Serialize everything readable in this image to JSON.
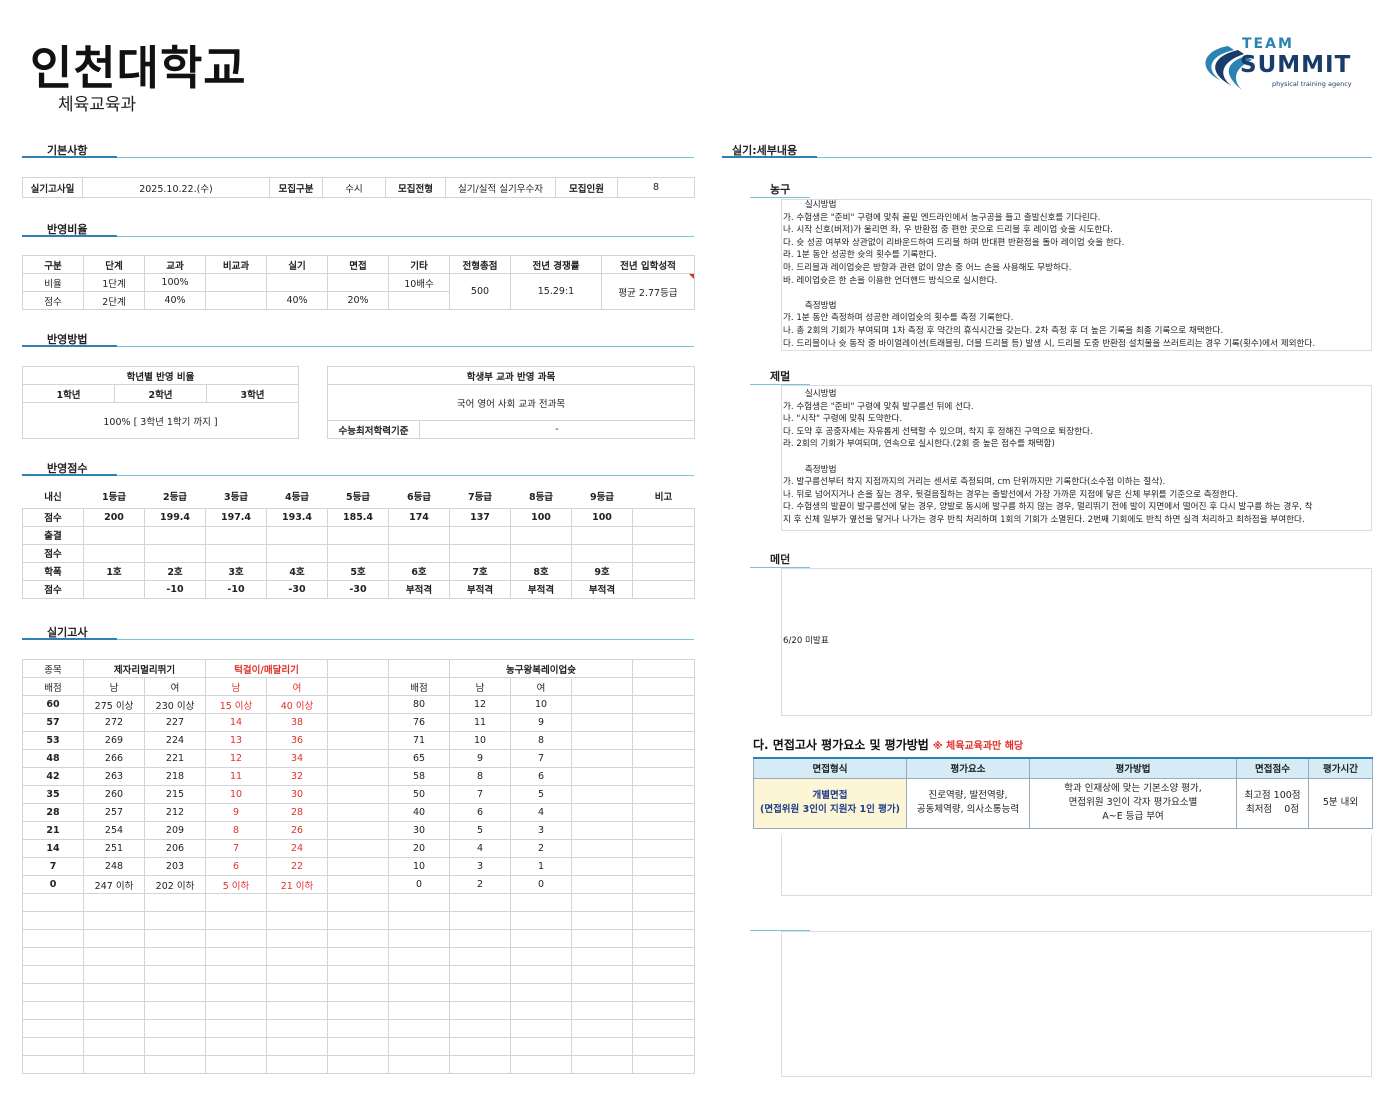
{
  "header": {
    "university": "인천대학교",
    "department": "체육교육과",
    "logo": {
      "line1": "TEAM",
      "line2": "SUMMIT",
      "line3": "physical training agency",
      "accent": "#2a83b2"
    }
  },
  "sections": {
    "basic": "기본사항",
    "ratio": "반영비율",
    "method": "반영방법",
    "score": "반영점수",
    "practical": "실기고사",
    "detail": "실기:세부내용"
  },
  "basic": {
    "labels": [
      "실기고사일",
      "모집구분",
      "모집전형",
      "모집인원"
    ],
    "values": [
      "2025.10.22.(수)",
      "수시",
      "실기/실적 실기우수자",
      "8"
    ]
  },
  "ratio": {
    "headers": [
      "구분",
      "단계",
      "교과",
      "비교과",
      "실기",
      "면접",
      "기타",
      "전형총점",
      "전년 경쟁률",
      "전년 입학성적"
    ],
    "rows": [
      [
        "비율",
        "1단계",
        "100%",
        "",
        "",
        "",
        "10배수"
      ],
      [
        "점수",
        "2단계",
        "40%",
        "",
        "40%",
        "20%",
        ""
      ]
    ],
    "total": "500",
    "competition": "15.29:1",
    "prev": "평균 2.77등급"
  },
  "method": {
    "grade_title": "학년별 반영 비율",
    "grades": [
      "1학년",
      "2학년",
      "3학년"
    ],
    "grade_value": "100% [ 3학년 1학기 까지 ]",
    "subject_title": "학생부 교과 반영 과목",
    "subject_value": "국어 영어 사회 교과 전과목",
    "min_label": "수능최저학력기준",
    "min_value": "-"
  },
  "score": {
    "headers": [
      "내신",
      "1등급",
      "2등급",
      "3등급",
      "4등급",
      "5등급",
      "6등급",
      "7등급",
      "8등급",
      "9등급",
      "비고"
    ],
    "r1": [
      "점수",
      "200",
      "199.4",
      "197.4",
      "193.4",
      "185.4",
      "174",
      "137",
      "100",
      "100",
      ""
    ],
    "r2": [
      "출결",
      "",
      "",
      "",
      "",
      "",
      "",
      "",
      "",
      "",
      ""
    ],
    "r3": [
      "점수",
      "",
      "",
      "",
      "",
      "",
      "",
      "",
      "",
      "",
      ""
    ],
    "r4": [
      "학폭",
      "1호",
      "2호",
      "3호",
      "4호",
      "5호",
      "6호",
      "7호",
      "8호",
      "9호",
      ""
    ],
    "r5": [
      "점수",
      "",
      "-10",
      "-10",
      "-30",
      "-30",
      "부적격",
      "부적격",
      "부적격",
      "부적격",
      ""
    ]
  },
  "practical": {
    "col_event": "종목",
    "ev1": "제자리멀리뛰기",
    "ev2": "턱걸이/매달리기",
    "ev3": "농구왕복레이업슛",
    "col_score": "배점",
    "m": "남",
    "f": "여",
    "rows": [
      [
        "60",
        "275 이상",
        "230 이상",
        "15 이상",
        "40 이상",
        "80",
        "12",
        "10"
      ],
      [
        "57",
        "272",
        "227",
        "14",
        "38",
        "76",
        "11",
        "9"
      ],
      [
        "53",
        "269",
        "224",
        "13",
        "36",
        "71",
        "10",
        "8"
      ],
      [
        "48",
        "266",
        "221",
        "12",
        "34",
        "65",
        "9",
        "7"
      ],
      [
        "42",
        "263",
        "218",
        "11",
        "32",
        "58",
        "8",
        "6"
      ],
      [
        "35",
        "260",
        "215",
        "10",
        "30",
        "50",
        "7",
        "5"
      ],
      [
        "28",
        "257",
        "212",
        "9",
        "28",
        "40",
        "6",
        "4"
      ],
      [
        "21",
        "254",
        "209",
        "8",
        "26",
        "30",
        "5",
        "3"
      ],
      [
        "14",
        "251",
        "206",
        "7",
        "24",
        "20",
        "4",
        "2"
      ],
      [
        "7",
        "248",
        "203",
        "6",
        "22",
        "10",
        "3",
        "1"
      ],
      [
        "0",
        "247 이하",
        "202 이하",
        "5 이하",
        "21 이하",
        "0",
        "2",
        "0"
      ]
    ]
  },
  "detail": {
    "basket": {
      "title": "농구",
      "text": "        실시방법\n가. 수험생은 \"준비\" 구령에 맞춰 골밑 엔드라인에서 농구공을 들고 출발신호를 기다린다.\n나. 시작 신호(버저)가 울리면 좌, 우 반환점 중 편한 곳으로 드리블 후 레이업 슛을 시도한다.\n다. 슛 성공 여부와 상관없이 리바운드하여 드리블 하며 반대편 반환점을 돌아 레이업 슛을 한다.\n라. 1분 동안 성공한 슛의 횟수를 기록한다.\n마. 드리블과 레이업슛은 방향과 관련 없이 양손 중 어느 손을 사용해도 무방하다.\n바. 레이업슛은 한 손을 이용한 언더핸드 방식으로 실시한다.\n\n        측정방법\n가. 1분 동안 측정하며 성공한 레이업슛의 횟수를 측정 기록한다.\n나. 총 2회의 기회가 부여되며 1차 측정 후 약간의 휴식시간을 갖는다. 2차 측정 후 더 높은 기록을 최종 기록으로 채택한다.\n다. 드리블이나 슛 동작 중 바이얼레이션(트래블링, 더블 드리블 등) 발생 시, 드리블 도중 반환점 설치물을 쓰러트리는 경우 기록(횟수)에서 제외한다."
    },
    "jump": {
      "title": "제멀",
      "text": "        실시방법\n가. 수험생은 \"준비\" 구령에 맞춰 발구름선 뒤에 선다.\n나. \"시작\" 구령에 맞춰 도약한다.\n다. 도약 후 공중자세는 자유롭게 선택할 수 있으며, 착지 후 정해진 구역으로 퇴장한다.\n라. 2회의 기회가 부여되며, 연속으로 실시한다.(2회 중 높은 점수를 채택함)\n\n        측정방법\n가. 발구름선부터 착지 지점까지의 거리는 센서로 측정되며, cm 단위까지만 기록한다(소수점 이하는 절삭).\n나. 뒤로 넘어지거나 손을 짚는 경우, 뒷걸음질하는 경우는 출발선에서 가장 가까운 지점에 닿은 신체 부위를 기준으로 측정한다.\n다. 수험생의 발끝이 발구름선에 닿는 경우, 양발로 동시에 발구름 하지 않는 경우, 멀리뛰기 전에 발이 지면에서 떨어진 후 다시 발구름 하는 경우, 착\n지 후 신체 일부가 옆선을 닿거나 나가는 경우 반칙 처리하며 1회의 기회가 소멸된다. 2번째 기회에도 반칙 하면 실격 처리하고 최하점을 부여한다."
    },
    "medicine": {
      "title": "메던",
      "text": "6/20 미발표"
    }
  },
  "interview": {
    "title": "다. 면접고사 평가요소 및 평가방법",
    "note": "※ 체육교육과만 해당",
    "headers": [
      "면접형식",
      "평가요소",
      "평가방법",
      "면접점수",
      "평가시간"
    ],
    "format1": "개별면접",
    "format2": "(면접위원 3인이 지원자 1인 평가)",
    "element1": "진로역량, 발전역량,",
    "element2": "공동체역량, 의사소통능력",
    "method1": "학과 인재상에 맞는 기본소양 평가,",
    "method2": "면접위원 3인이 각자 평가요소별",
    "method3": "A~E 등급 부여",
    "score1": "최고점 100점",
    "score2": "최저점    0점",
    "time": "5분 내외"
  }
}
